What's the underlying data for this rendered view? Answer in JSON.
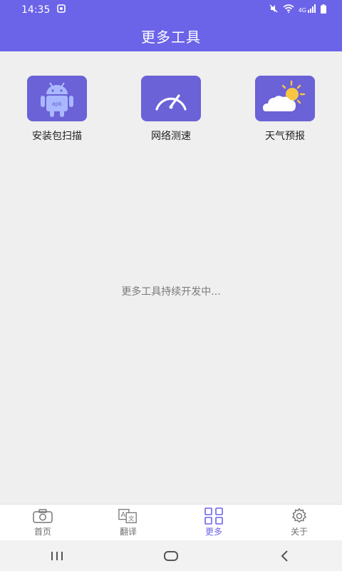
{
  "status_bar": {
    "time": "14:35",
    "network": "4G"
  },
  "header": {
    "title": "更多工具"
  },
  "tools": [
    {
      "label": "安装包扫描",
      "icon": "android-apk-icon",
      "icon_text": "apk"
    },
    {
      "label": "网络测速",
      "icon": "speedometer-icon"
    },
    {
      "label": "天气预报",
      "icon": "weather-sun-cloud-icon"
    }
  ],
  "main": {
    "dev_message": "更多工具持续开发中..."
  },
  "bottom_nav": {
    "active_index": 2,
    "items": [
      {
        "label": "首页",
        "icon": "camera-icon"
      },
      {
        "label": "翻译",
        "icon": "translate-icon"
      },
      {
        "label": "更多",
        "icon": "grid-icon"
      },
      {
        "label": "关于",
        "icon": "gear-icon"
      }
    ]
  },
  "colors": {
    "primary": "#6b63e8",
    "tool_bg": "#6a62d6",
    "background": "#efefef"
  }
}
